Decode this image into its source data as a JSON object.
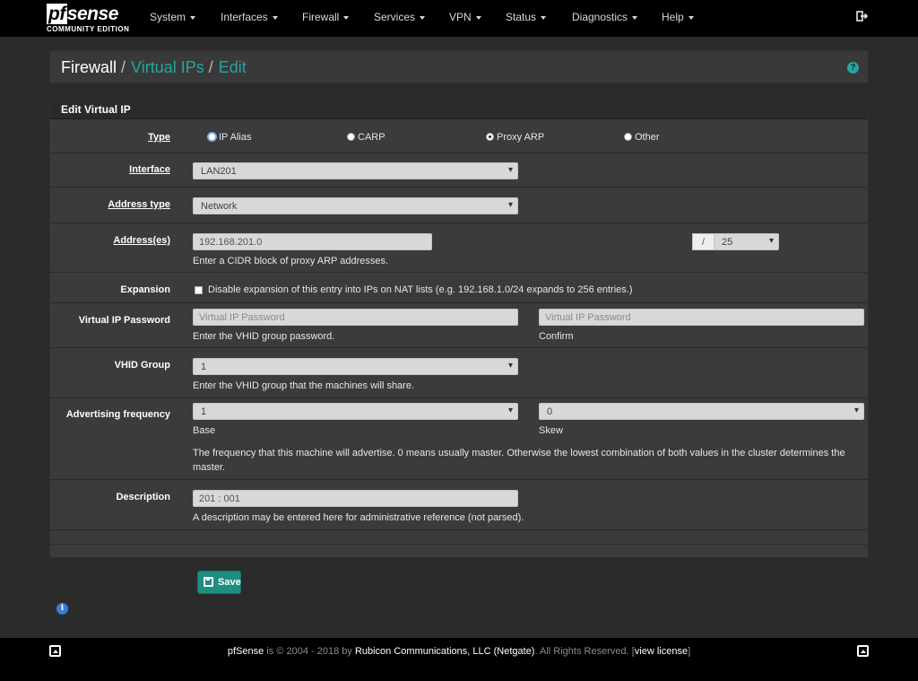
{
  "brand": {
    "name_prefix": "pf",
    "name_suffix": "sense",
    "edition": "COMMUNITY EDITION"
  },
  "nav": [
    "System",
    "Interfaces",
    "Firewall",
    "Services",
    "VPN",
    "Status",
    "Diagnostics",
    "Help"
  ],
  "breadcrumb": {
    "root": "Firewall",
    "section": "Virtual IPs",
    "page": "Edit",
    "separator": "/"
  },
  "panel_title": "Edit Virtual IP",
  "form": {
    "type": {
      "label": "Type",
      "options": [
        "IP Alias",
        "CARP",
        "Proxy ARP",
        "Other"
      ],
      "selected": "Proxy ARP"
    },
    "interface": {
      "label": "Interface",
      "value": "LAN201"
    },
    "address_type": {
      "label": "Address type",
      "value": "Network"
    },
    "address": {
      "label": "Address(es)",
      "value": "192.168.201.0",
      "slash": "/",
      "mask": "25",
      "help": "Enter a CIDR block of proxy ARP addresses."
    },
    "expansion": {
      "label": "Expansion",
      "checkbox_label": "Disable expansion of this entry into IPs on NAT lists (e.g. 192.168.1.0/24 expands to 256 entries.)",
      "checked": false
    },
    "password": {
      "label": "Virtual IP Password",
      "placeholder": "Virtual IP Password",
      "help": "Enter the VHID group password.",
      "confirm_placeholder": "Virtual IP Password",
      "confirm_label": "Confirm"
    },
    "vhid": {
      "label": "VHID Group",
      "value": "1",
      "help": "Enter the VHID group that the machines will share."
    },
    "advskew": {
      "label": "Advertising frequency",
      "base_value": "1",
      "base_label": "Base",
      "skew_value": "0",
      "skew_label": "Skew",
      "help": "The frequency that this machine will advertise. 0 means usually master. Otherwise the lowest combination of both values in the cluster determines the master."
    },
    "description": {
      "label": "Description",
      "value": "201 : 001",
      "help": "A description may be entered here for administrative reference (not parsed)."
    }
  },
  "save_label": "Save",
  "footer": {
    "product": "pfSense",
    "is": "is",
    "copyright": "© 2004 - 2018 by",
    "company": "Rubicon Communications, LLC (Netgate)",
    "rights": ". All Rights Reserved. [",
    "license": "view license",
    "close": "]"
  }
}
